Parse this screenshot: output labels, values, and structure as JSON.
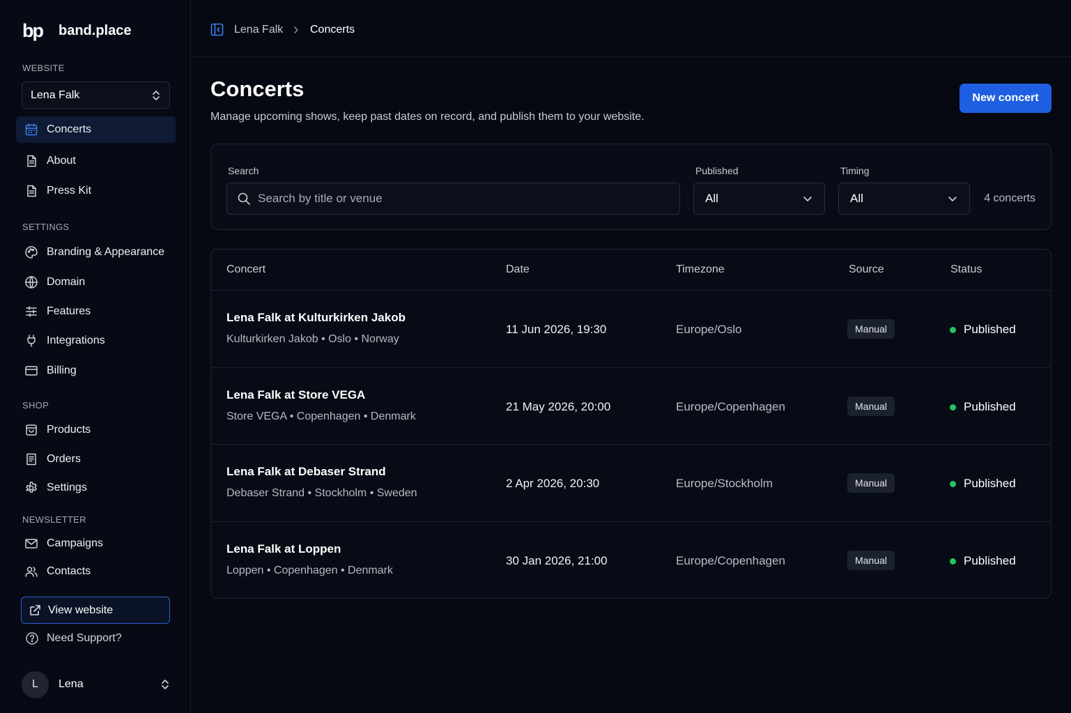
{
  "brand": {
    "logo": "bp",
    "name": "band.place"
  },
  "sidebar": {
    "website_label": "WEBSITE",
    "website_select": "Lena Falk",
    "settings_label": "SETTINGS",
    "shop_label": "SHOP",
    "newsletter_label": "NEWSLETTER",
    "items": [
      {
        "label": "Concerts",
        "icon": "calendar-icon",
        "active": true
      },
      {
        "label": "About",
        "icon": "document-icon"
      },
      {
        "label": "Press Kit",
        "icon": "document-icon"
      },
      {
        "label": "Branding & Appearance",
        "icon": "palette-icon"
      },
      {
        "label": "Domain",
        "icon": "globe-icon"
      },
      {
        "label": "Features",
        "icon": "sliders-icon"
      },
      {
        "label": "Integrations",
        "icon": "plug-icon"
      },
      {
        "label": "Billing",
        "icon": "credit-card-icon"
      },
      {
        "label": "Products",
        "icon": "shopping-bag-icon"
      },
      {
        "label": "Orders",
        "icon": "receipt-icon"
      },
      {
        "label": "Settings",
        "icon": "gear-icon"
      },
      {
        "label": "Campaigns",
        "icon": "mail-icon"
      },
      {
        "label": "Contacts",
        "icon": "users-icon"
      }
    ],
    "view_website": "View website",
    "support": "Need Support?",
    "user": {
      "initial": "L",
      "name": "Lena"
    }
  },
  "topbar": {
    "breadcrumb": [
      "Lena Falk",
      "Concerts"
    ]
  },
  "main": {
    "title": "Concerts",
    "subtitle": "Manage upcoming shows, keep past dates on record, and publish them to your website.",
    "new_button": "New concert",
    "filters": {
      "search_label": "Search",
      "search_placeholder": "Search by title or venue",
      "published_label": "Published",
      "published_value": "All",
      "timing_label": "Timing",
      "timing_value": "All",
      "count": "4 concerts"
    },
    "table": {
      "columns": [
        "Concert",
        "Date",
        "Timezone",
        "Source",
        "Status"
      ],
      "rows": [
        {
          "title": "Lena Falk at Kulturkirken Jakob",
          "venue": "Kulturkirken Jakob • Oslo • Norway",
          "date": "11 Jun 2026, 19:30",
          "timezone": "Europe/Oslo",
          "source": "Manual",
          "status": "Published"
        },
        {
          "title": "Lena Falk at Store VEGA",
          "venue": "Store VEGA • Copenhagen • Denmark",
          "date": "21 May 2026, 20:00",
          "timezone": "Europe/Copenhagen",
          "source": "Manual",
          "status": "Published"
        },
        {
          "title": "Lena Falk at Debaser Strand",
          "venue": "Debaser Strand • Stockholm • Sweden",
          "date": "2 Apr 2026, 20:30",
          "timezone": "Europe/Stockholm",
          "source": "Manual",
          "status": "Published"
        },
        {
          "title": "Lena Falk at Loppen",
          "venue": "Loppen • Copenhagen • Denmark",
          "date": "30 Jan 2026, 21:00",
          "timezone": "Europe/Copenhagen",
          "source": "Manual",
          "status": "Published"
        }
      ]
    }
  },
  "colors": {
    "accent": "#1d5fe0",
    "status_published": "#22c55e",
    "background": "#060912"
  }
}
